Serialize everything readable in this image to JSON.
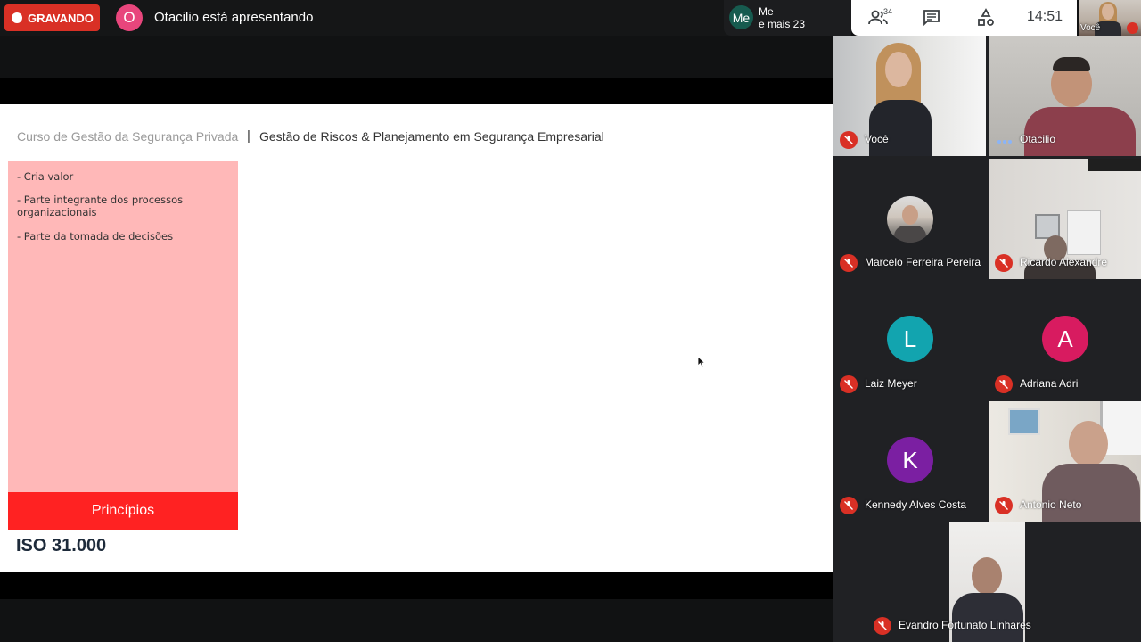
{
  "topbar": {
    "recording_label": "GRAVANDO",
    "presenter_initial": "O",
    "presenting_text": "Otacilio está apresentando",
    "me_chip": {
      "avatar_text": "Me",
      "line1": "Me",
      "line2": "e mais 23"
    }
  },
  "toolbar": {
    "participants_count": "34",
    "time": "14:51",
    "self_label": "Você",
    "icons": [
      "people-icon",
      "chat-icon",
      "activities-icon"
    ]
  },
  "slide": {
    "course": "Curso de Gestão da Segurança Privada",
    "separator": "|",
    "title": "Gestão de Riscos & Planejamento em Segurança Empresarial",
    "items": [
      "- Cria valor",
      "- Parte integrante dos processos organizacionais",
      "- Parte da tomada de decisões"
    ],
    "section_label": "Princípios",
    "iso_label": "ISO 31.000"
  },
  "participants": [
    {
      "name": "Você",
      "type": "video",
      "muted": true
    },
    {
      "name": "Otacilio",
      "type": "video",
      "muted": false,
      "speaking": true
    },
    {
      "name": "Marcelo Ferreira Pereira",
      "type": "photo",
      "muted": true
    },
    {
      "name": "Ricardo Alexandre",
      "type": "video",
      "muted": true
    },
    {
      "name": "Laiz Meyer",
      "type": "letter",
      "initial": "L",
      "color": "#12a4af",
      "muted": true
    },
    {
      "name": "Adriana Adri",
      "type": "letter",
      "initial": "A",
      "color": "#d81b60",
      "muted": true
    },
    {
      "name": "Kennedy Alves Costa",
      "type": "letter",
      "initial": "K",
      "color": "#7b1fa2",
      "muted": true
    },
    {
      "name": "Antonio Neto",
      "type": "video",
      "muted": true
    },
    {
      "name": "Evandro Fortunato Linhares",
      "type": "video",
      "muted": true
    }
  ],
  "colors": {
    "recording": "#d93025",
    "slide_pink": "#ffb8b8",
    "slide_red": "#ff2222"
  }
}
